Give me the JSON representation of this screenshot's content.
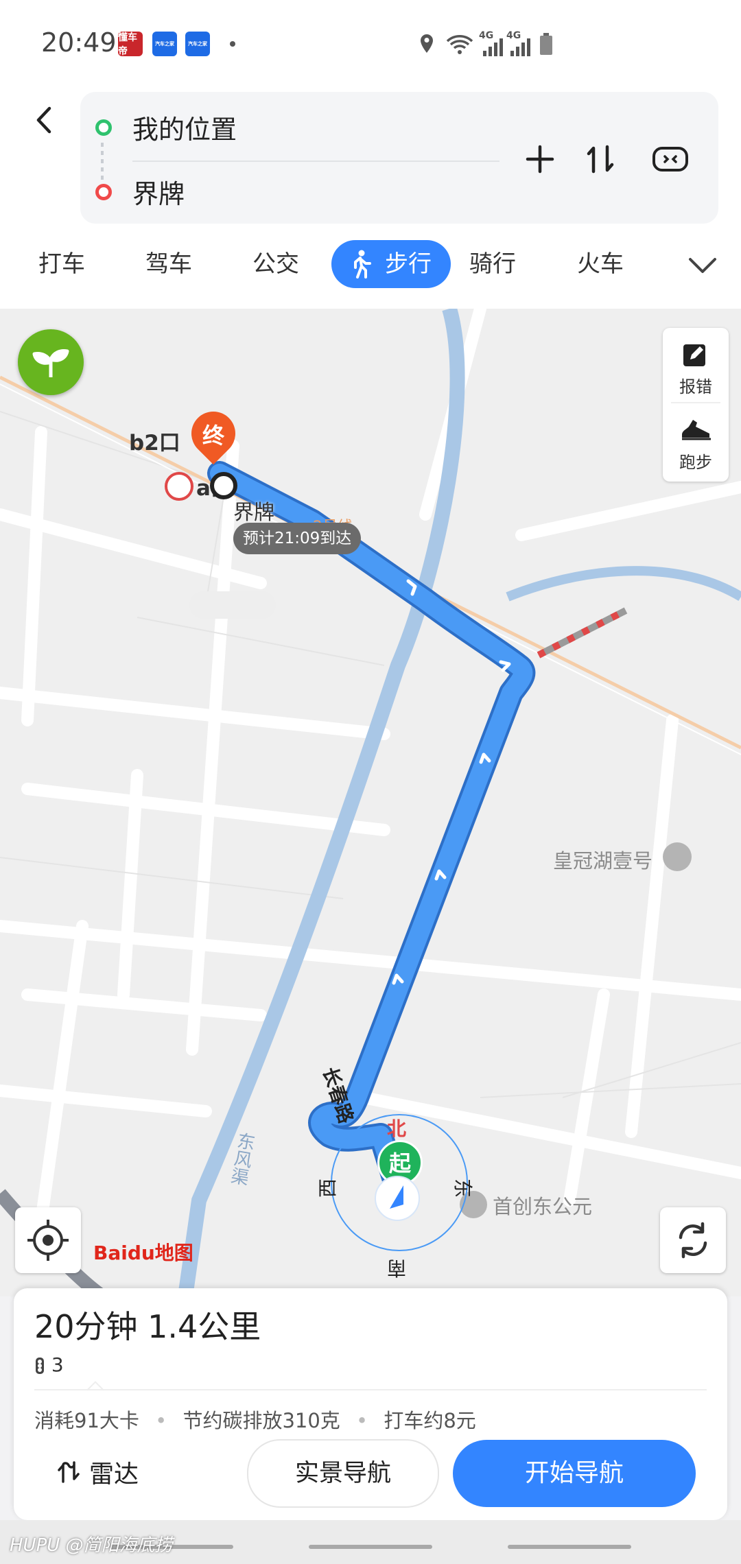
{
  "status_bar": {
    "time": "20:49",
    "apps": [
      "懂车帝",
      "汽车之家",
      "汽车之家"
    ],
    "icons": [
      "location-icon",
      "wifi-icon",
      "signal-4g-icon",
      "signal-4g-icon",
      "battery-icon"
    ],
    "network_label": "4G"
  },
  "route": {
    "origin": "我的位置",
    "destination": "界牌"
  },
  "tabs": [
    "打车",
    "驾车",
    "公交",
    "步行",
    "骑行",
    "火车"
  ],
  "active_tab": "步行",
  "map": {
    "side_buttons": [
      "报错",
      "跑步"
    ],
    "markers": {
      "end_badge": "终",
      "start_badge": "起",
      "exit_b2": "b2口",
      "exit_a": "a口",
      "dest_label": "界牌",
      "eta": "预计21:09到达",
      "road": "长春路",
      "river": "东风渠",
      "poi1": "皇冠湖壹号",
      "poi2": "首创东公元",
      "line_label": "2号线"
    },
    "compass": {
      "n": "北",
      "e": "东",
      "s": "南",
      "w": "西"
    },
    "logo": "Baidu地图"
  },
  "summary": {
    "duration_distance": "20分钟  1.4公里",
    "traffic_lights": "3",
    "calories": "消耗91大卡",
    "carbon": "节约碳排放310克",
    "taxi": "打车约8元"
  },
  "buttons": {
    "radar": "雷达",
    "ar_nav": "实景导航",
    "start_nav": "开始导航"
  },
  "watermark": "HUPU @简阳海底捞",
  "colors": {
    "accent": "#3385ff",
    "route": "#4a9af5",
    "end_marker": "#f05a24",
    "start_marker": "#1fb35b"
  }
}
